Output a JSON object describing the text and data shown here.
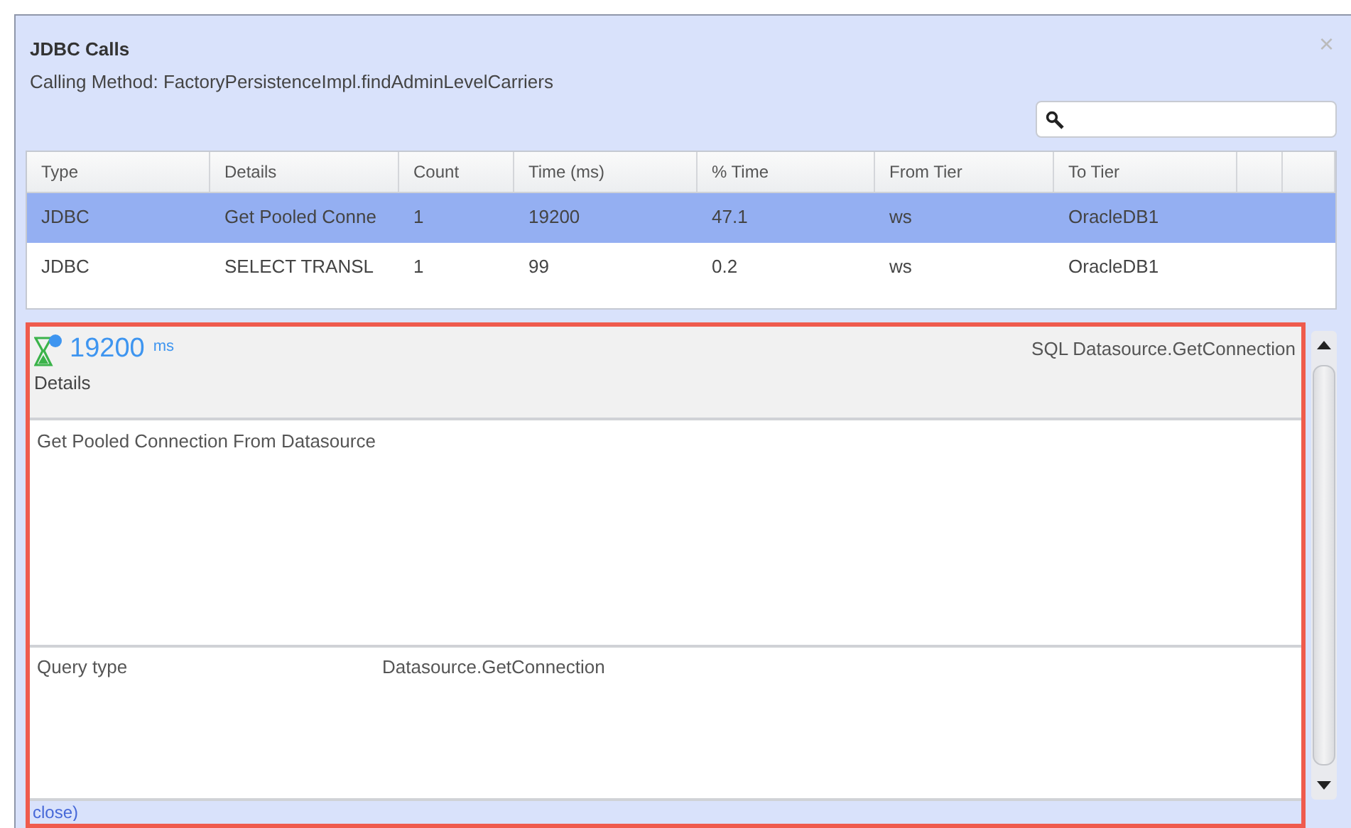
{
  "window": {
    "title": "JDBC Calls",
    "subtitle": "Calling Method: FactoryPersistenceImpl.findAdminLevelCarriers",
    "close": "×"
  },
  "table": {
    "columns": [
      "Type",
      "Details",
      "Count",
      "Time (ms)",
      "% Time",
      "From Tier",
      "To Tier"
    ],
    "rows": [
      {
        "selected": true,
        "cells": [
          "JDBC",
          "Get Pooled Conne",
          "1",
          "19200",
          "47.1",
          "ws",
          "OracleDB1"
        ]
      },
      {
        "selected": false,
        "cells": [
          "JDBC",
          "SELECT TRANSL",
          "1",
          "99",
          "0.2",
          "ws",
          "OracleDB1"
        ]
      }
    ]
  },
  "detail": {
    "time": "19200",
    "unit": "ms",
    "operation": "SQL Datasource.GetConnection",
    "section": "Details",
    "description": "Get Pooled Connection From Datasource",
    "properties": [
      {
        "name": "Query type",
        "value": "Datasource.GetConnection"
      }
    ],
    "link": "close)"
  }
}
